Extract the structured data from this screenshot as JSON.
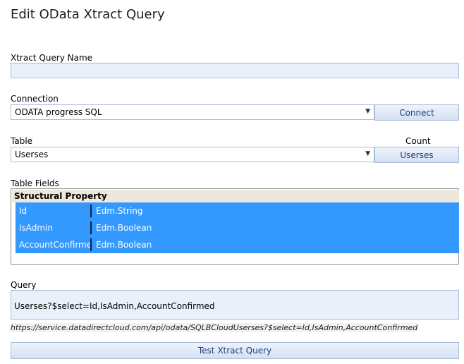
{
  "dialog": {
    "title": "Edit OData Xtract Query"
  },
  "query_name": {
    "label": "Xtract Query Name",
    "value": ""
  },
  "connection": {
    "label": "Connection",
    "selected": "ODATA progress SQL",
    "button_label": "Connect"
  },
  "table": {
    "label": "Table",
    "selected": "Userses",
    "count_label": "Count",
    "count_button_label": "Userses"
  },
  "table_fields": {
    "label": "Table Fields",
    "header": "Structural Property",
    "rows": [
      {
        "name": "Id",
        "type": "Edm.String"
      },
      {
        "name": "IsAdmin",
        "type": "Edm.Boolean"
      },
      {
        "name": "AccountConfirmed",
        "type": "Edm.Boolean"
      }
    ]
  },
  "query": {
    "label": "Query",
    "value": "Userses?$select=Id,IsAdmin,AccountConfirmed",
    "url": "https://service.datadirectcloud.com/api/odata/SQLBCloudUserses?$select=Id,IsAdmin,AccountConfirmed"
  },
  "test_button_label": "Test Xtract Query",
  "icons": {
    "dropdown": "chevron-down-icon"
  },
  "colors": {
    "selection": "#3399ff",
    "field_bg": "#eaf0fa",
    "header_bg": "#ede7dc",
    "button_text": "#1f3f78"
  }
}
